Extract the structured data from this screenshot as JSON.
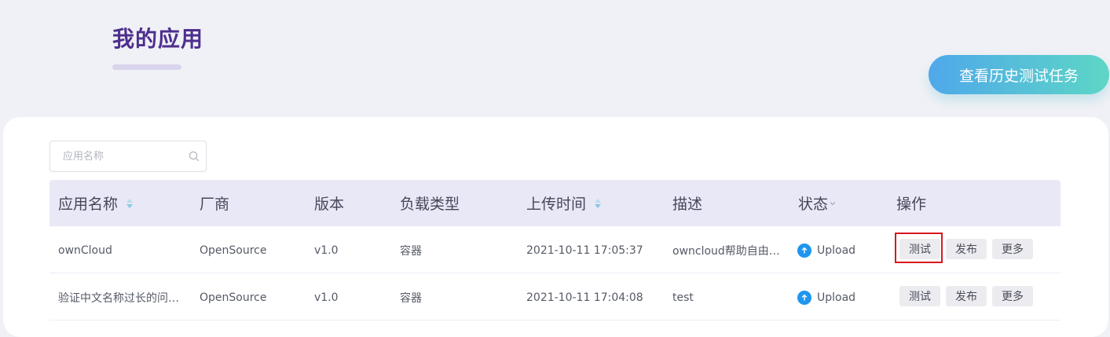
{
  "page": {
    "title": "我的应用"
  },
  "header": {
    "history_button": "查看历史测试任务"
  },
  "search": {
    "placeholder": "应用名称"
  },
  "table": {
    "columns": [
      "应用名称",
      "厂商",
      "版本",
      "负载类型",
      "上传时间",
      "描述",
      "状态",
      "操作"
    ],
    "rows": [
      {
        "name": "ownCloud",
        "vendor": "OpenSource",
        "version": "v1.0",
        "workload": "容器",
        "upload_time": "2021-10-11 17:05:37",
        "description": "owncloud帮助自由…",
        "status": "Upload"
      },
      {
        "name": "验证中文名称过长的问…",
        "vendor": "OpenSource",
        "version": "v1.0",
        "workload": "容器",
        "upload_time": "2021-10-11 17:04:08",
        "description": "test",
        "status": "Upload"
      }
    ],
    "actions": {
      "test": "测试",
      "publish": "发布",
      "more": "更多"
    }
  },
  "colors": {
    "title": "#4e2f8e",
    "accent_gradient_start": "#4fa8ea",
    "accent_gradient_end": "#5dd6c6",
    "status_icon": "#1e96ef",
    "highlight": "#d9181e",
    "sort_icon": "#86c8e4"
  },
  "icons": {
    "search": "search-icon",
    "sort": "sort-icon",
    "filter": "chevron-down-icon",
    "status": "upload-arrow-icon"
  }
}
